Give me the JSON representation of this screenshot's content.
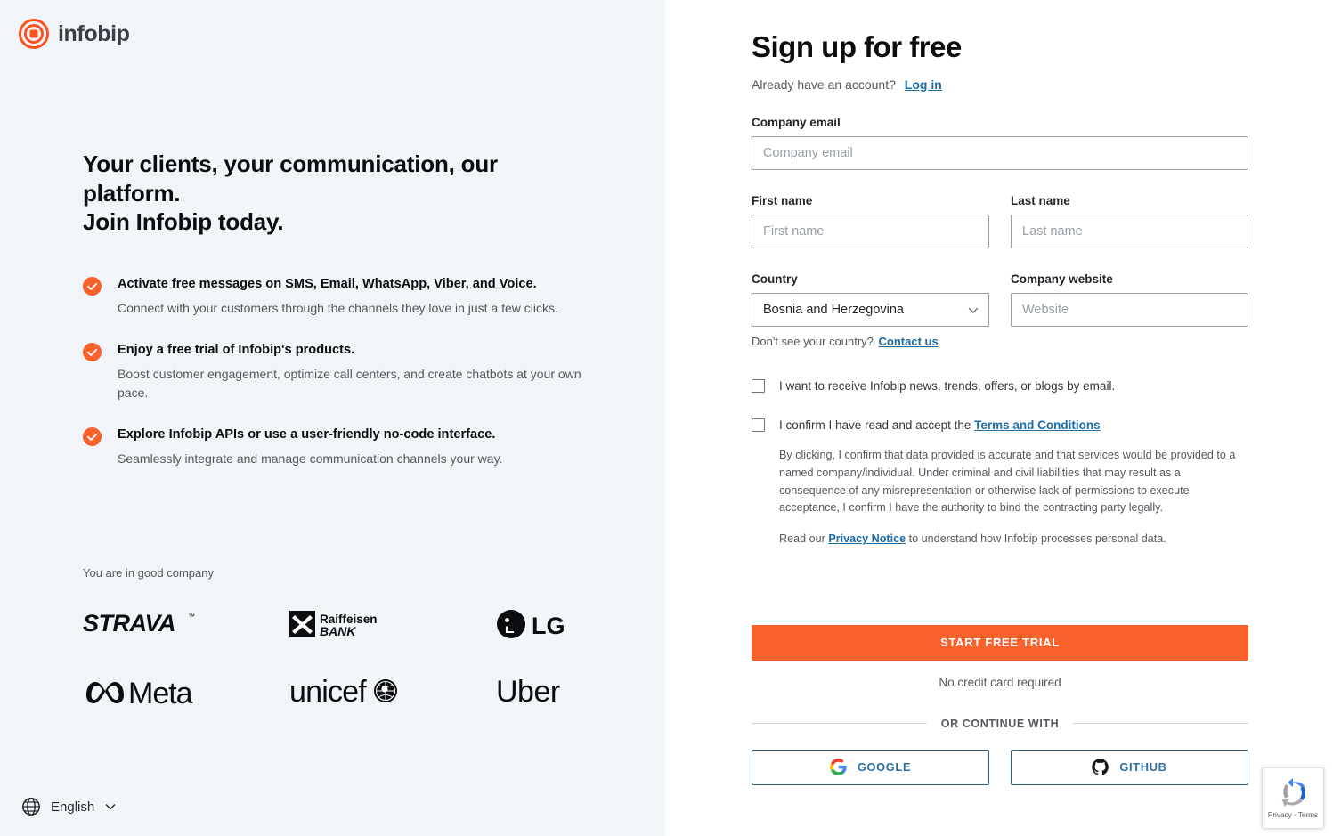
{
  "brand": {
    "name": "infobip",
    "logo_color": "#F9541E",
    "wordmark_color": "#3B3F45"
  },
  "left": {
    "headline": "Your clients, your communication, our platform.\nJoin Infobip today.",
    "benefits": [
      {
        "icon": "check-circle-icon",
        "title": "Activate free messages on SMS, Email, WhatsApp, Viber, and Voice.",
        "description": "Connect with your customers through the channels they love in just a few clicks."
      },
      {
        "icon": "check-circle-icon",
        "title": "Enjoy a free trial of Infobip's products.",
        "description": "Boost customer engagement, optimize call centers, and create chatbots at your own pace."
      },
      {
        "icon": "check-circle-icon",
        "title": "Explore Infobip APIs or use a user-friendly no-code interface.",
        "description": "Seamlessly integrate and manage communication channels your way."
      }
    ],
    "good_company_label": "You are in good company",
    "logos": [
      {
        "name": "STRAVA"
      },
      {
        "name": "Raiffeisen BANK"
      },
      {
        "name": "LG"
      },
      {
        "name": "Meta"
      },
      {
        "name": "unicef"
      },
      {
        "name": "Uber"
      }
    ],
    "language": {
      "icon": "globe-icon",
      "label": "English",
      "chevron": "chevron-down-icon"
    }
  },
  "form": {
    "title": "Sign up for free",
    "already_account_text": "Already have an account?",
    "login_link": "Log in",
    "fields": {
      "company_email": {
        "label": "Company email",
        "placeholder": "Company email",
        "value": ""
      },
      "first_name": {
        "label": "First name",
        "placeholder": "First name",
        "value": ""
      },
      "last_name": {
        "label": "Last name",
        "placeholder": "Last name",
        "value": ""
      },
      "country": {
        "label": "Country",
        "value": "Bosnia and Herzegovina",
        "chevron": "chevron-down-icon"
      },
      "company_website": {
        "label": "Company website",
        "placeholder": "Website",
        "value": ""
      }
    },
    "country_helper": {
      "text": "Don't see your country?",
      "link": "Contact us"
    },
    "checkboxes": [
      {
        "name": "marketing-opt-in",
        "label": "I want to receive Infobip news, trends, offers, or blogs by email.",
        "checked": false
      },
      {
        "name": "terms-accept",
        "label": "I confirm I have read and accept the",
        "link": "Terms and Conditions",
        "checked": false
      }
    ],
    "legal": {
      "paragraph": "By clicking, I confirm that data provided is accurate and that services would be provided to a named company/individual. Under criminal and civil liabilities that may result as a consequence of any misrepresentation or otherwise lack of permissions to execute acceptance, I confirm I have the authority to bind the contracting party legally.",
      "privacy_prefix": "Read our",
      "privacy_link": "Privacy Notice",
      "privacy_suffix": "to understand how Infobip processes personal data."
    },
    "submit_button": "START FREE TRIAL",
    "submit_note": "No credit card required",
    "divider_text": "OR CONTINUE WITH",
    "social_buttons": [
      {
        "icon": "google-icon",
        "label": "GOOGLE"
      },
      {
        "icon": "github-icon",
        "label": "GITHUB"
      }
    ]
  },
  "recaptcha": {
    "icon": "recaptcha-icon",
    "text": "Privacy - Terms"
  },
  "colors": {
    "accent_orange": "#F8612C",
    "left_panel_bg": "#F1F4F9",
    "link_blue": "#1B6CA8",
    "social_blue": "#2C6DA0"
  }
}
